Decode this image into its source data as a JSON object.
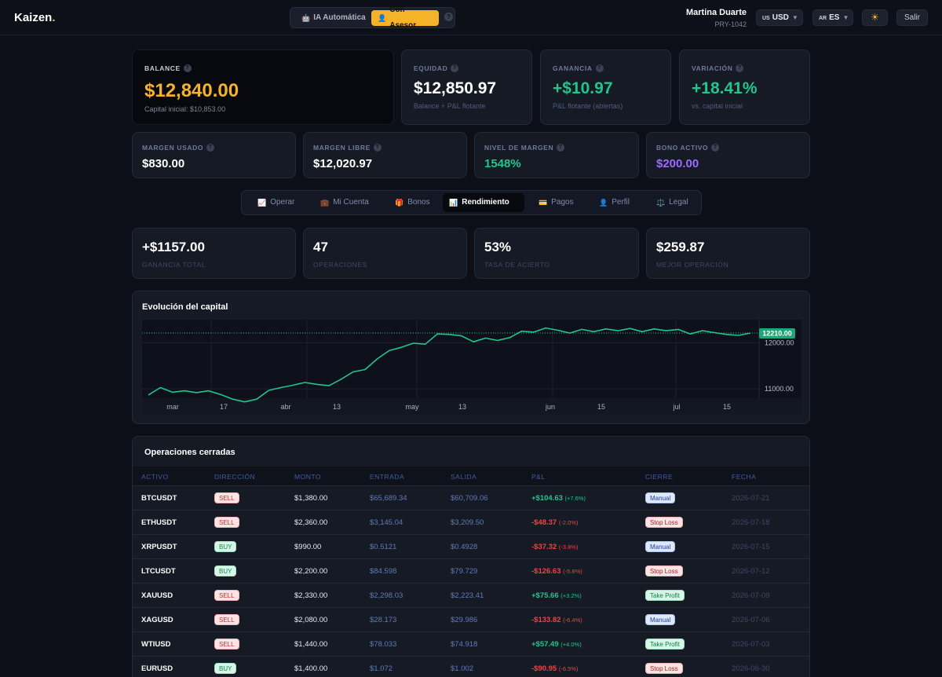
{
  "header": {
    "logo": "Kaizen",
    "logo_dot": ".",
    "mode_ia": "IA Automática",
    "mode_asesor": "Con Asesor",
    "help": "?",
    "user_name": "Martina Duarte",
    "user_id": "PRY-1042",
    "currency_flag": "US",
    "currency": "USD",
    "lang_flag": "AR",
    "lang": "ES",
    "logout": "Salir"
  },
  "balance": {
    "label": "BALANCE",
    "value": "$12,840.00",
    "sub": "Capital inicial: $10,853.00"
  },
  "kpis": [
    {
      "label": "EQUIDAD",
      "value": "$12,850.97",
      "sub": "Balance + P&L flotante"
    },
    {
      "label": "GANANCIA",
      "value": "+$10.97",
      "sub": "P&L flotante (abiertas)"
    },
    {
      "label": "VARIACIÓN",
      "value": "+18.41%",
      "sub": "vs. capital inicial"
    }
  ],
  "margins": [
    {
      "label": "MARGEN USADO",
      "value": "$830.00"
    },
    {
      "label": "MARGEN LIBRE",
      "value": "$12,020.97"
    },
    {
      "label": "NIVEL DE MARGEN",
      "value": "1548%"
    },
    {
      "label": "BONO ACTIVO",
      "value": "$200.00"
    }
  ],
  "tabs": [
    {
      "icon": "📈",
      "label": "Operar"
    },
    {
      "icon": "💼",
      "label": "Mi Cuenta"
    },
    {
      "icon": "🎁",
      "label": "Bonos"
    },
    {
      "icon": "📊",
      "label": "Rendimiento"
    },
    {
      "icon": "💳",
      "label": "Pagos"
    },
    {
      "icon": "👤",
      "label": "Perfil"
    },
    {
      "icon": "⚖️",
      "label": "Legal"
    }
  ],
  "stats": [
    {
      "value": "+$1157.00",
      "label": "GANANCIA TOTAL"
    },
    {
      "value": "47",
      "label": "OPERACIONES"
    },
    {
      "value": "53%",
      "label": "TASA DE ACIERTO"
    },
    {
      "value": "$259.87",
      "label": "MEJOR OPERACIÓN"
    }
  ],
  "chart_data": {
    "type": "line",
    "title": "Evolución del capital",
    "x_tick_labels": [
      "mar",
      "17",
      "abr",
      "13",
      "may",
      "13",
      "jun",
      "15",
      "jul",
      "15"
    ],
    "y_tick_labels": [
      "12000.00",
      "11000.00"
    ],
    "ylim": [
      10800,
      12500
    ],
    "last_value_label": "12210.00",
    "grid": true,
    "series": [
      {
        "values": [
          10870,
          11030,
          10930,
          10960,
          10920,
          10960,
          10880,
          10780,
          10720,
          10780,
          10970,
          11030,
          11080,
          11140,
          11100,
          11070,
          11210,
          11370,
          11420,
          11650,
          11830,
          11900,
          11990,
          11970,
          12190,
          12180,
          12150,
          12020,
          12100,
          12050,
          12110,
          12250,
          12230,
          12320,
          12270,
          12210,
          12290,
          12240,
          12300,
          12260,
          12310,
          12240,
          12300,
          12260,
          12290,
          12190,
          12260,
          12220,
          12180,
          12160,
          12210
        ]
      }
    ]
  },
  "table": {
    "title": "Operaciones cerradas",
    "headers": [
      "ACTIVO",
      "DIRECCIÓN",
      "MONTO",
      "ENTRADA",
      "SALIDA",
      "P&L",
      "CIERRE",
      "FECHA"
    ],
    "rows": [
      {
        "asset": "BTCUSDT",
        "dir": "SELL",
        "amount": "$1,380.00",
        "entry": "$65,689.34",
        "exit": "$60,709.06",
        "pnl": "+$104.63",
        "pct": "(+7.6%)",
        "close": "Manual",
        "date": "2026-07-21"
      },
      {
        "asset": "ETHUSDT",
        "dir": "SELL",
        "amount": "$2,360.00",
        "entry": "$3,145.04",
        "exit": "$3,209.50",
        "pnl": "-$48.37",
        "pct": "(-2.0%)",
        "close": "Stop Loss",
        "date": "2026-07-18"
      },
      {
        "asset": "XRPUSDT",
        "dir": "BUY",
        "amount": "$990.00",
        "entry": "$0.5121",
        "exit": "$0.4928",
        "pnl": "-$37.32",
        "pct": "(-3.8%)",
        "close": "Manual",
        "date": "2026-07-15"
      },
      {
        "asset": "LTCUSDT",
        "dir": "BUY",
        "amount": "$2,200.00",
        "entry": "$84.598",
        "exit": "$79.729",
        "pnl": "-$126.63",
        "pct": "(-5.8%)",
        "close": "Stop Loss",
        "date": "2026-07-12"
      },
      {
        "asset": "XAUUSD",
        "dir": "SELL",
        "amount": "$2,330.00",
        "entry": "$2,298.03",
        "exit": "$2,223.41",
        "pnl": "+$75.66",
        "pct": "(+3.2%)",
        "close": "Take Profit",
        "date": "2026-07-09"
      },
      {
        "asset": "XAGUSD",
        "dir": "SELL",
        "amount": "$2,080.00",
        "entry": "$28.173",
        "exit": "$29.986",
        "pnl": "-$133.82",
        "pct": "(-6.4%)",
        "close": "Manual",
        "date": "2026-07-06"
      },
      {
        "asset": "WTIUSD",
        "dir": "SELL",
        "amount": "$1,440.00",
        "entry": "$78.033",
        "exit": "$74.918",
        "pnl": "+$57.49",
        "pct": "(+4.0%)",
        "close": "Take Profit",
        "date": "2026-07-03"
      },
      {
        "asset": "EURUSD",
        "dir": "BUY",
        "amount": "$1,400.00",
        "entry": "$1.072",
        "exit": "$1.002",
        "pnl": "-$90.95",
        "pct": "(-6.5%)",
        "close": "Stop Loss",
        "date": "2026-06-30"
      }
    ]
  }
}
